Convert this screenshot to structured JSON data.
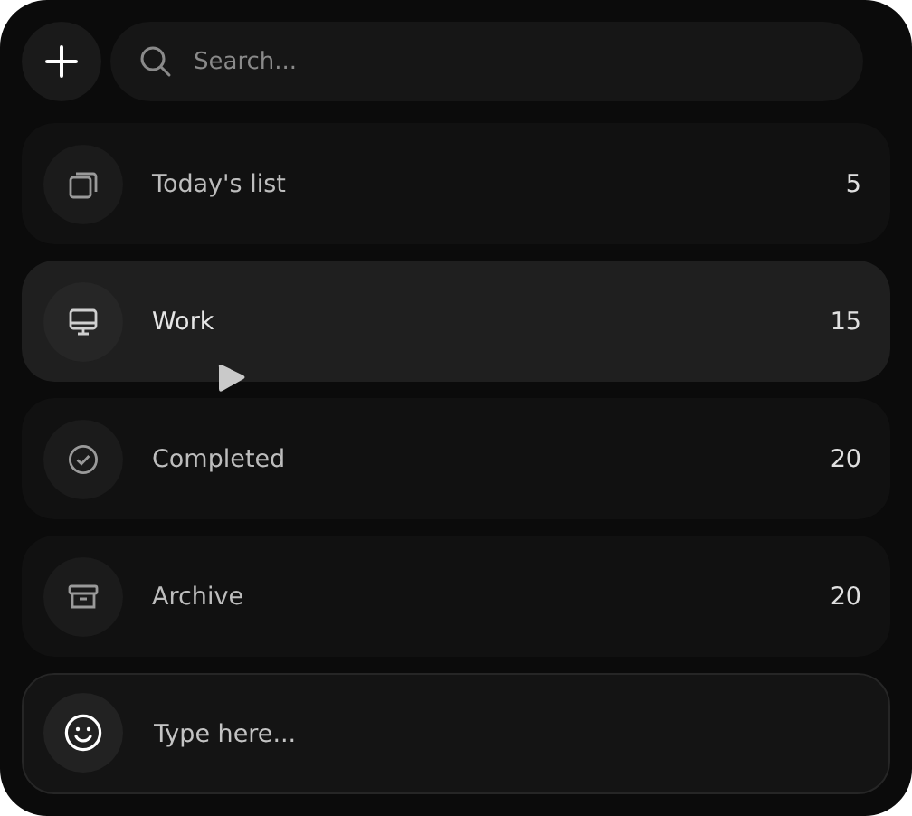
{
  "search": {
    "placeholder": "Search..."
  },
  "lists": [
    {
      "label": "Today's list",
      "count": "5",
      "selected": false
    },
    {
      "label": "Work",
      "count": "15",
      "selected": true
    },
    {
      "label": "Completed",
      "count": "20",
      "selected": false
    },
    {
      "label": "Archive",
      "count": "20",
      "selected": false
    }
  ],
  "composer": {
    "placeholder": "Type here..."
  }
}
